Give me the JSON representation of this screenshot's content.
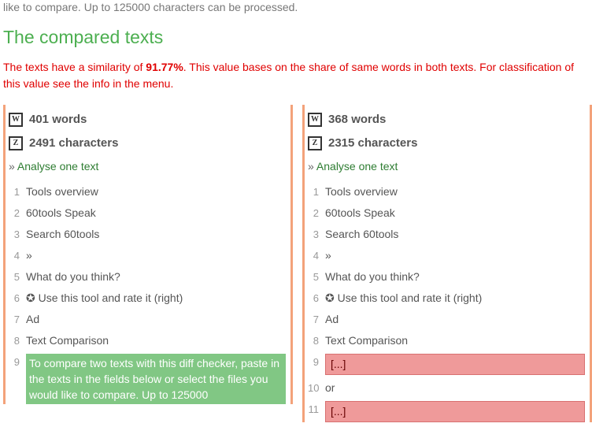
{
  "intro_tail": "like to compare. Up to 125000 characters can be processed.",
  "section_title": "The compared texts",
  "similarity_prefix": "The texts have a similarity of ",
  "similarity_value": "91.77%",
  "similarity_suffix": ". This value bases on the share of same words in both texts. For classification of this value see the info in the menu.",
  "left": {
    "words": "401 words",
    "chars": "2491 characters",
    "analyse_prefix": "» ",
    "analyse": "Analyse one text",
    "lines": [
      {
        "n": "1",
        "t": "Tools overview"
      },
      {
        "n": "2",
        "t": "60tools Speak"
      },
      {
        "n": "3",
        "t": "Search 60tools"
      },
      {
        "n": "4",
        "t": "»"
      },
      {
        "n": "5",
        "t": "What do you think?"
      },
      {
        "n": "6",
        "t": "✪ Use this tool and rate it (right)"
      },
      {
        "n": "7",
        "t": "Ad"
      },
      {
        "n": "8",
        "t": "Text Comparison"
      },
      {
        "n": "9",
        "t": "To compare two texts with this diff checker, paste in the texts in the fields below or select the files you would like to compare. Up to 125000",
        "hl": "green"
      }
    ]
  },
  "right": {
    "words": "368 words",
    "chars": "2315 characters",
    "analyse_prefix": "» ",
    "analyse": "Analyse one text",
    "lines": [
      {
        "n": "1",
        "t": "Tools overview"
      },
      {
        "n": "2",
        "t": "60tools Speak"
      },
      {
        "n": "3",
        "t": "Search 60tools"
      },
      {
        "n": "4",
        "t": "»"
      },
      {
        "n": "5",
        "t": "What do you think?"
      },
      {
        "n": "6",
        "t": "✪ Use this tool and rate it (right)"
      },
      {
        "n": "7",
        "t": "Ad"
      },
      {
        "n": "8",
        "t": "Text Comparison"
      },
      {
        "n": "9",
        "t": "[...]",
        "hl": "red"
      },
      {
        "n": "10",
        "t": "or"
      },
      {
        "n": "11",
        "t": "[...]",
        "hl": "red"
      }
    ]
  },
  "icons": {
    "w": "W",
    "z": "Z"
  }
}
